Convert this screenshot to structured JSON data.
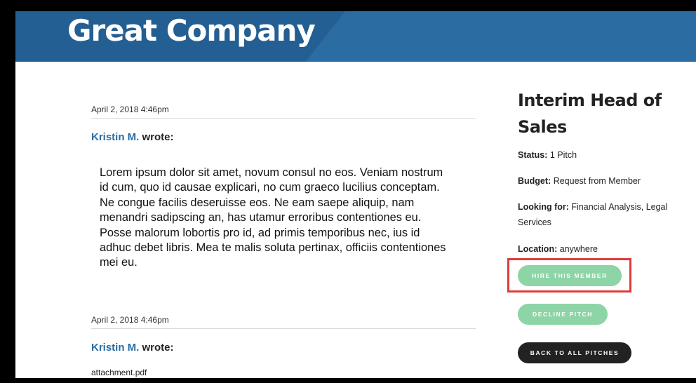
{
  "brand": {
    "logo_text": "Great Company"
  },
  "posts": [
    {
      "date": "April 2, 2018 4:46pm",
      "author": "Kristin M.",
      "wrote": "wrote:",
      "body": "Lorem ipsum dolor sit amet, novum consul no eos. Veniam nostrum id cum, quo id causae explicari, no cum graeco lucilius conceptam. Ne congue facilis deseruisse eos. Ne eam saepe aliquip, nam menandri sadipscing an, has utamur erroribus contentiones eu. Posse malorum lobortis pro id, ad primis temporibus nec, ius id adhuc debet libris. Mea te malis soluta pertinax, officiis contentiones mei eu."
    },
    {
      "date": "April 2, 2018 4:46pm",
      "author": "Kristin M.",
      "wrote": "wrote:",
      "attachment": "attachment.pdf"
    }
  ],
  "sidebar": {
    "title": "Interim Head of Sales",
    "status_label": "Status:",
    "status_value": "1 Pitch",
    "budget_label": "Budget:",
    "budget_value": "Request from Member",
    "looking_label": "Looking for:",
    "looking_value": "Financial Analysis, Legal Services",
    "location_label": "Location:",
    "location_value": "anywhere"
  },
  "actions": {
    "hire_label": "HIRE THIS MEMBER",
    "decline_label": "DECLINE PITCH",
    "back_label": "BACK TO ALL PITCHES"
  },
  "colors": {
    "header_blue": "#2b6ca3",
    "button_green": "#8dd4a6",
    "button_dark": "#222222",
    "highlight_red": "#e03b3b"
  }
}
